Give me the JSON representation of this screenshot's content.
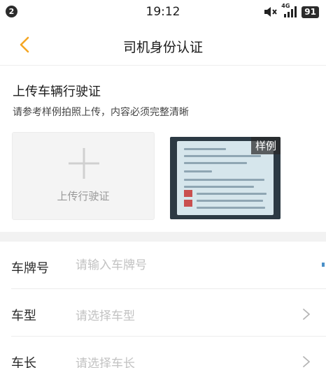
{
  "status_bar": {
    "notification_count": "2",
    "time": "19:12",
    "network": "4G",
    "battery": "91"
  },
  "header": {
    "title": "司机身份认证"
  },
  "upload": {
    "title": "上传车辆行驶证",
    "description": "请参考样例拍照上传，内容必须完整清晰",
    "upload_label": "上传行驶证",
    "sample_tag": "样例"
  },
  "form": {
    "rows": [
      {
        "label": "车牌号",
        "placeholder": "请输入车牌号"
      },
      {
        "label": "车型",
        "placeholder": "请选择车型"
      },
      {
        "label": "车长",
        "placeholder": "请选择车长"
      }
    ]
  },
  "colors": {
    "accent": "#f5a623",
    "page_bg": "#f2f2f2",
    "placeholder": "#c2c2c2"
  },
  "icons": {
    "back": "chevron-left-icon",
    "mute": "mute-icon",
    "signal": "signal-icon",
    "plus": "plus-icon",
    "chevron": "chevron-right-icon"
  }
}
